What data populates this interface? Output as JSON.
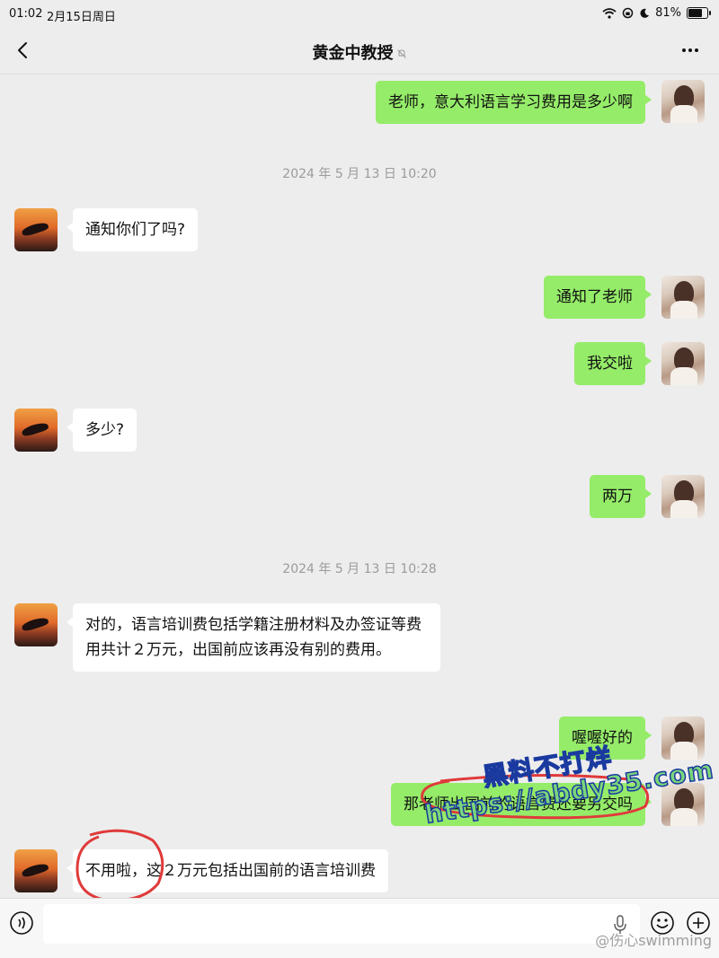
{
  "status_bar": {
    "time": "01:02",
    "date": "2月15日周日",
    "battery": "81%",
    "battery_level": 0.81
  },
  "header": {
    "title": "黄金中教授"
  },
  "messages": [
    {
      "from": "me",
      "text": "老师，意大利语言学习费用是多少啊"
    },
    {
      "from": "system",
      "text": "2024 年 5 月 13 日 10:20"
    },
    {
      "from": "other",
      "text": "通知你们了吗?"
    },
    {
      "from": "me",
      "text": "通知了老师"
    },
    {
      "from": "me",
      "text": "我交啦"
    },
    {
      "from": "other",
      "text": "多少?"
    },
    {
      "from": "me",
      "text": "两万"
    },
    {
      "from": "system",
      "text": "2024 年 5 月 13 日 10:28"
    },
    {
      "from": "other",
      "text": "对的，语言培训费包括学籍注册材料及办签证等费用共计２万元，出国前应该再没有别的费用。"
    },
    {
      "from": "me",
      "text": "喔喔好的"
    },
    {
      "from": "me",
      "text": "那老师出国前的语言费还要另交吗"
    },
    {
      "from": "other",
      "text": "不用啦，这２万元包括出国前的语言培训费"
    }
  ],
  "input": {
    "value": "",
    "placeholder": ""
  },
  "watermark": {
    "line1": "黑料不打烊",
    "line2": "https://abdy35.com"
  },
  "weibo_watermark": "@伤心swimming",
  "colors": {
    "background": "#ededed",
    "my_bubble": "#95ec69",
    "other_bubble": "#ffffff",
    "timestamp": "#9b9b9b",
    "red_annotation": "#e03a3a"
  }
}
